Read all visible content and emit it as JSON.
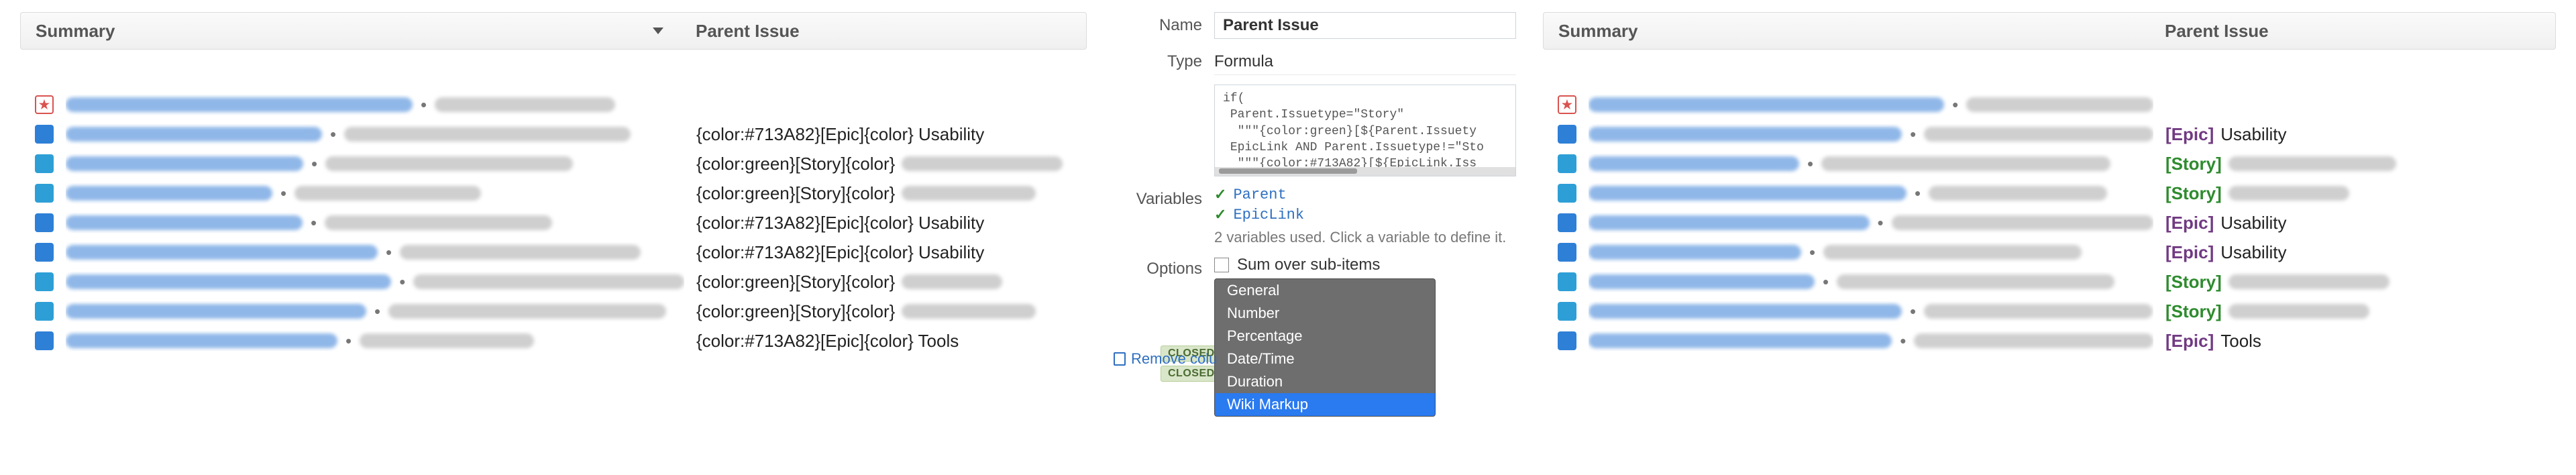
{
  "columns": {
    "summary": "Summary",
    "parent": "Parent Issue"
  },
  "left_rows": [
    {
      "icon": "ic-fav",
      "parent_kind": "",
      "parent_text": "",
      "trailing_blur": 200
    },
    {
      "icon": "ic-issue",
      "parent_kind": "epic-raw",
      "parent_text": "Usability"
    },
    {
      "icon": "ic-sub",
      "parent_kind": "story-raw",
      "parent_text": "",
      "trailing_blur": 240
    },
    {
      "icon": "ic-sub",
      "parent_kind": "story-raw",
      "parent_text": "",
      "trailing_blur": 200
    },
    {
      "icon": "ic-issue",
      "parent_kind": "epic-raw",
      "parent_text": "Usability"
    },
    {
      "icon": "ic-issue",
      "parent_kind": "epic-raw",
      "parent_text": "Usability"
    },
    {
      "icon": "ic-sub",
      "parent_kind": "story-raw",
      "parent_text": "",
      "trailing_blur": 150
    },
    {
      "icon": "ic-sub",
      "parent_kind": "story-raw",
      "parent_text": "",
      "trailing_blur": 200
    },
    {
      "icon": "ic-issue",
      "parent_kind": "epic-raw",
      "parent_text": "Tools"
    }
  ],
  "right_rows": [
    {
      "icon": "ic-fav",
      "parent_kind": "",
      "parent_text": ""
    },
    {
      "icon": "ic-issue",
      "parent_kind": "epic",
      "parent_text": "Usability"
    },
    {
      "icon": "ic-sub",
      "parent_kind": "story",
      "parent_text": "",
      "trailing_blur": 250
    },
    {
      "icon": "ic-sub",
      "parent_kind": "story",
      "parent_text": "",
      "trailing_blur": 180
    },
    {
      "icon": "ic-issue",
      "parent_kind": "epic",
      "parent_text": "Usability"
    },
    {
      "icon": "ic-issue",
      "parent_kind": "epic",
      "parent_text": "Usability"
    },
    {
      "icon": "ic-sub",
      "parent_kind": "story",
      "parent_text": "",
      "trailing_blur": 240
    },
    {
      "icon": "ic-sub",
      "parent_kind": "story",
      "parent_text": "",
      "trailing_blur": 210
    },
    {
      "icon": "ic-issue",
      "parent_kind": "epic",
      "parent_text": "Tools"
    }
  ],
  "editor": {
    "labels": {
      "name": "Name",
      "type": "Type",
      "variables": "Variables",
      "options": "Options"
    },
    "name_value": "Parent Issue",
    "type_value": "Formula",
    "code": "if(\n Parent.Issuetype=\"Story\"\n  \"\"\"{color:green}[${Parent.Issuety\n EpicLink AND Parent.Issuetype!=\"Sto\n  \"\"\"{color:#713A82}[${EpicLink.Iss\n)",
    "variables": [
      "Parent",
      "EpicLink"
    ],
    "vars_hint": "2 variables used. Click a variable to define it.",
    "sum_label": "Sum over sub-items",
    "remove_label": "Remove colu",
    "closed_label": "CLOSED",
    "dropdown": {
      "items": [
        "General",
        "Number",
        "Percentage",
        "Date/Time",
        "Duration",
        "Wiki Markup"
      ],
      "selected_index": 5
    }
  },
  "raw_epic_prefix": "{color:#713A82}[Epic]{color}",
  "raw_story_prefix": "{color:green}[Story]{color}",
  "epic_tag": "[Epic]",
  "story_tag": "[Story]"
}
